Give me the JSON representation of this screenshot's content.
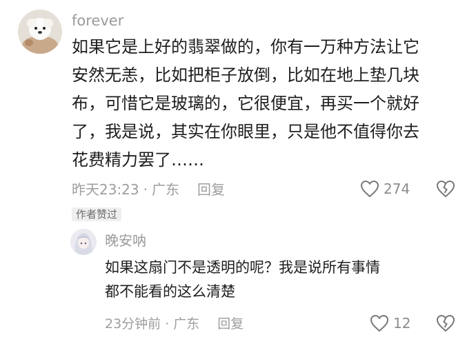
{
  "comment": {
    "username": "forever",
    "lines": [
      "如果它是上好的翡翠做的，你有一万种方法让它",
      "安然无恙，比如把柜子放倒，比如在地上垫几块",
      "布，可惜它是玻璃的，它很便宜，再买一个就好",
      "了，我是说，其实在你眼里，只是他不值得你去",
      "花费精力罢了……"
    ],
    "time": "昨天23:23",
    "location": "广东",
    "reply_label": "回复",
    "like_count": "274",
    "author_badge": "作者赞过"
  },
  "reply": {
    "username": "晚安呐",
    "lines": [
      "如果这扇门不是透明的呢？我是说所有事情",
      "都不能看的这么清楚"
    ],
    "time": "23分钟前",
    "location": "广东",
    "reply_label": "回复",
    "like_count": "12"
  },
  "icons": {
    "like": "heart-outline-icon",
    "dislike": "broken-heart-icon"
  },
  "colors": {
    "text": "#1d1d1d",
    "meta": "#9d9d9d",
    "badge_bg": "#efefef"
  }
}
